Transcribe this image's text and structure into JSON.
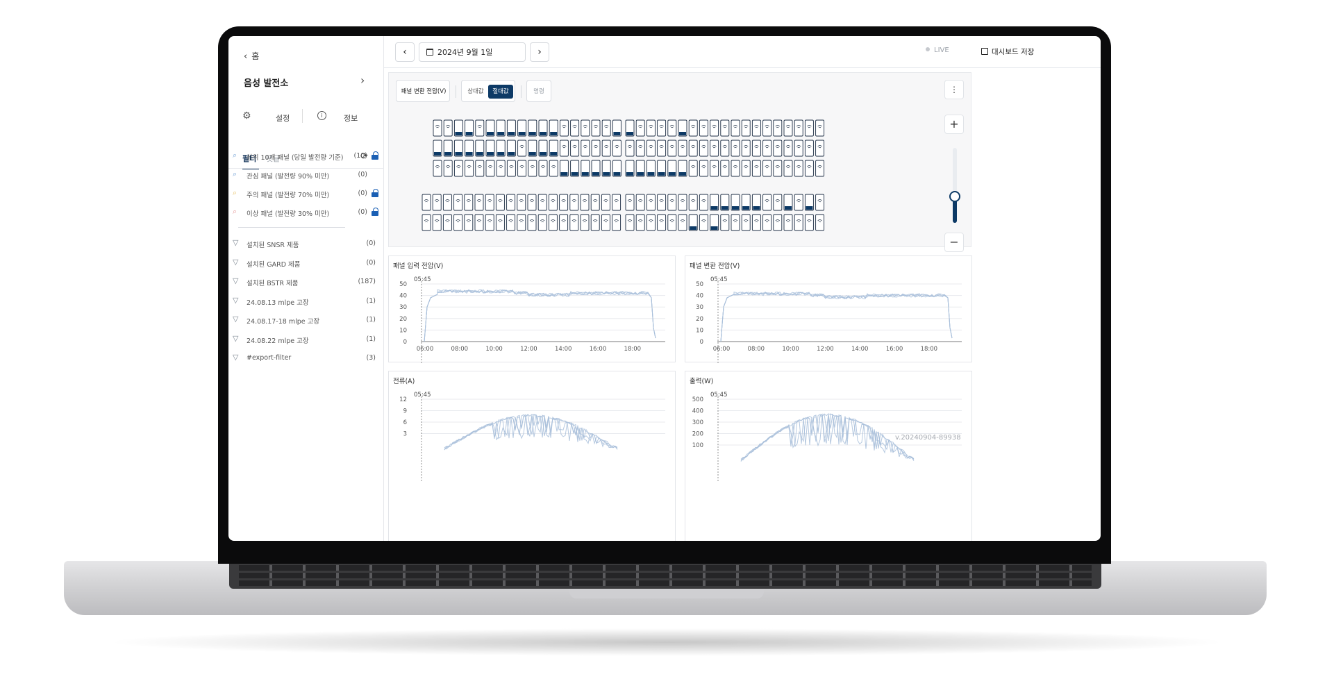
{
  "sidebar": {
    "home_label": "홈",
    "site_name": "음성 발전소",
    "settings_label": "설정",
    "info_label": "정보",
    "tabs": [
      {
        "label": "필터",
        "active": true
      },
      {
        "label": "댓글",
        "active": false
      }
    ],
    "filters": [
      {
        "icon": "search-icon",
        "color": "#7aa7d8",
        "label": "상위 10개 패널 (당일 발전량 기준)",
        "count": "(10)",
        "locked": true
      },
      {
        "icon": "search-icon",
        "color": "#7aa7d8",
        "label": "관심 패널 (발전량 90% 미만)",
        "count": "(0)",
        "locked": false
      },
      {
        "icon": "search-icon",
        "color": "#e8c46a",
        "label": "주의 패널 (발전량 70% 미만)",
        "count": "(0)",
        "locked": true
      },
      {
        "icon": "search-icon",
        "color": "#e59a9a",
        "label": "이상 패널 (발전량 30% 미만)",
        "count": "(0)",
        "locked": true
      }
    ],
    "tag_filters": [
      {
        "label": "설치된 SNSR 제품",
        "count": "(0)"
      },
      {
        "label": "설치된 GARD 제품",
        "count": "(0)"
      },
      {
        "label": "설치된 BSTR 제품",
        "count": "(187)"
      },
      {
        "label": "24.08.13 mlpe 고장",
        "count": "(1)"
      },
      {
        "label": "24.08.17-18 mlpe 고장",
        "count": "(1)"
      },
      {
        "label": "24.08.22 mlpe 고장",
        "count": "(1)"
      },
      {
        "label": "#export-filter",
        "count": "(3)"
      }
    ]
  },
  "topbar": {
    "date_label": "2024년 9월 1일",
    "live_label": "LIVE",
    "save_label": "대시보드 저장"
  },
  "map": {
    "metric_label": "패널 변환 전압(V)",
    "relative_label": "상대값",
    "absolute_label": "절대값",
    "name_label": "명령",
    "accent": "#0d3a66"
  },
  "charts": [
    {
      "title": "패널 입력 전압(V)",
      "marker": "05:45",
      "y_ticks": [
        "50",
        "40",
        "30",
        "20",
        "10",
        "0"
      ],
      "x_ticks": [
        "06:00",
        "08:00",
        "10:00",
        "12:00",
        "14:00",
        "16:00",
        "18:00"
      ],
      "shape": "plateau",
      "plateau_value": 42
    },
    {
      "title": "패널 변환 전압(V)",
      "marker": "05:45",
      "y_ticks": [
        "50",
        "40",
        "30",
        "20",
        "10",
        "0"
      ],
      "x_ticks": [
        "06:00",
        "08:00",
        "10:00",
        "12:00",
        "14:00",
        "16:00",
        "18:00"
      ],
      "shape": "plateau",
      "plateau_value": 40
    },
    {
      "title": "전류(A)",
      "marker": "05:45",
      "y_ticks": [
        "12",
        "9",
        "6",
        "3"
      ],
      "x_ticks": [],
      "shape": "bell"
    },
    {
      "title": "출력(W)",
      "marker": "05:45",
      "y_ticks": [
        "500",
        "400",
        "300",
        "200",
        "100"
      ],
      "x_ticks": [],
      "shape": "bell"
    }
  ],
  "version_label": "v.20240904-89938"
}
